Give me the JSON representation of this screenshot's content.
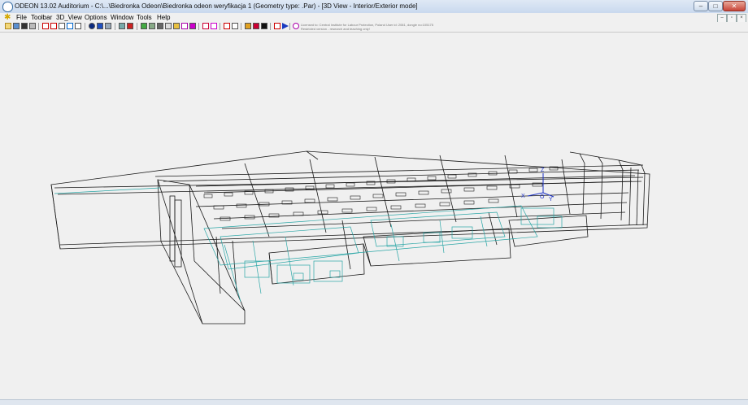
{
  "window": {
    "title": "ODEON 13.02 Auditorium  -  C:\\...\\Biedronka Odeon\\Biedronka odeon weryfikacja 1       (Geometry type: .Par) - [3D View - Interior/Exterior mode]",
    "minimize_glyph": "–",
    "maximize_glyph": "□",
    "close_glyph": "✕"
  },
  "menu": {
    "items": [
      "File",
      "Toolbar",
      "3D_View",
      "Options",
      "Window",
      "Tools",
      "Help"
    ]
  },
  "mdi_controls": {
    "minimize": "–",
    "restore": "▫",
    "close": "×"
  },
  "license": {
    "line1": "Licensed to: Central Institute for Labour Protection, Poland   User id: 2061, dongle no:105175",
    "line2": "Restricted version - research and teaching only!"
  },
  "axes": {
    "x": "X",
    "y": "Y",
    "z": "Z",
    "origin": "O"
  },
  "colors": {
    "outline": "#1a1a1a",
    "interior": "#2aa6a6",
    "axis": "#1c32c8"
  },
  "icons": [
    "folder-open-icon",
    "save-icon",
    "list-icon",
    "print-icon",
    "grid-icon",
    "grid-icon",
    "surface-icon",
    "chart-icon",
    "table-icon",
    "info-icon",
    "material-icon",
    "source-icon",
    "receiver-icon",
    "render-icon",
    "ray-icon",
    "grid-map-icon",
    "tools-icon",
    "wire-icon",
    "zoom-icon",
    "measure-icon",
    "highlight-icon",
    "layer-icon",
    "edit-icon",
    "calc-icon",
    "report-icon",
    "options-icon",
    "play-icon",
    "link-icon"
  ]
}
